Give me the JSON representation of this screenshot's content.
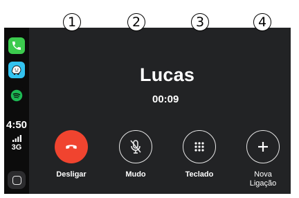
{
  "sidebar": {
    "apps": [
      {
        "name": "phone",
        "icon": "phone-icon"
      },
      {
        "name": "waze",
        "icon": "waze-icon"
      },
      {
        "name": "spotify",
        "icon": "spotify-icon"
      }
    ],
    "time": "4:50",
    "network": "3G",
    "home_icon": "home-button-icon"
  },
  "call": {
    "contact_name": "Lucas",
    "duration": "00:09"
  },
  "controls": [
    {
      "number": "1",
      "label": "Desligar",
      "icon": "hang-up-icon"
    },
    {
      "number": "2",
      "label": "Mudo",
      "icon": "mute-mic-icon"
    },
    {
      "number": "3",
      "label": "Teclado",
      "icon": "keypad-icon"
    },
    {
      "number": "4",
      "label_line1": "Nova",
      "label_line2": "Ligação",
      "icon": "plus-icon"
    }
  ],
  "colors": {
    "hangup": "#f0442f",
    "screen_bg": "#222325",
    "sidebar_bg": "#0c0c0c",
    "phone_app": "#3ccb4e",
    "waze_app": "#33c3f0",
    "spotify_app": "#1db954"
  }
}
